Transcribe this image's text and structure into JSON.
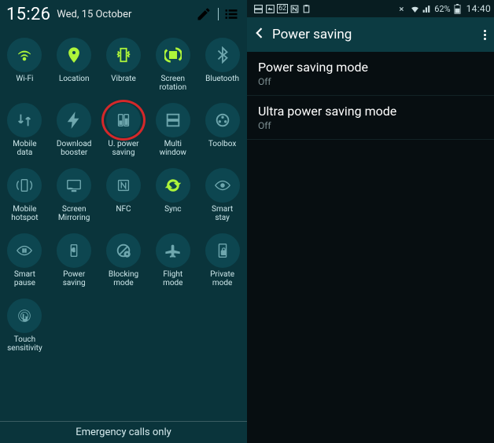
{
  "left": {
    "time": "15:26",
    "date": "Wed, 15 October",
    "tiles": [
      {
        "label": "Wi-Fi",
        "name": "wifi-icon",
        "on": true
      },
      {
        "label": "Location",
        "name": "location-icon",
        "on": true
      },
      {
        "label": "Vibrate",
        "name": "vibrate-icon",
        "on": true
      },
      {
        "label": "Screen\nrotation",
        "name": "screen-rotation-icon",
        "on": true
      },
      {
        "label": "Bluetooth",
        "name": "bluetooth-icon",
        "on": false
      },
      {
        "label": "Mobile\ndata",
        "name": "mobile-data-icon",
        "on": false
      },
      {
        "label": "Download\nbooster",
        "name": "download-booster-icon",
        "on": false
      },
      {
        "label": "U. power\nsaving",
        "name": "ultra-power-saving-icon",
        "on": false,
        "highlighted": true
      },
      {
        "label": "Multi\nwindow",
        "name": "multi-window-icon",
        "on": false
      },
      {
        "label": "Toolbox",
        "name": "toolbox-icon",
        "on": false
      },
      {
        "label": "Mobile\nhotspot",
        "name": "mobile-hotspot-icon",
        "on": false
      },
      {
        "label": "Screen\nMirroring",
        "name": "screen-mirroring-icon",
        "on": false
      },
      {
        "label": "NFC",
        "name": "nfc-icon",
        "on": false
      },
      {
        "label": "Sync",
        "name": "sync-icon",
        "on": true
      },
      {
        "label": "Smart\nstay",
        "name": "smart-stay-icon",
        "on": false
      },
      {
        "label": "Smart\npause",
        "name": "smart-pause-icon",
        "on": false
      },
      {
        "label": "Power\nsaving",
        "name": "power-saving-icon",
        "on": false
      },
      {
        "label": "Blocking\nmode",
        "name": "blocking-mode-icon",
        "on": false
      },
      {
        "label": "Flight\nmode",
        "name": "flight-mode-icon",
        "on": false
      },
      {
        "label": "Private\nmode",
        "name": "private-mode-icon",
        "on": false
      },
      {
        "label": "Touch\nsensitivity",
        "name": "touch-sensitivity-icon",
        "on": false
      }
    ],
    "footer": "Emergency calls only"
  },
  "right": {
    "status": {
      "battery_box": "62",
      "battery_pct": "62%",
      "time": "14:40"
    },
    "action_bar": {
      "title": "Power saving"
    },
    "items": [
      {
        "primary": "Power saving mode",
        "secondary": "Off"
      },
      {
        "primary": "Ultra power saving mode",
        "secondary": "Off"
      }
    ]
  }
}
